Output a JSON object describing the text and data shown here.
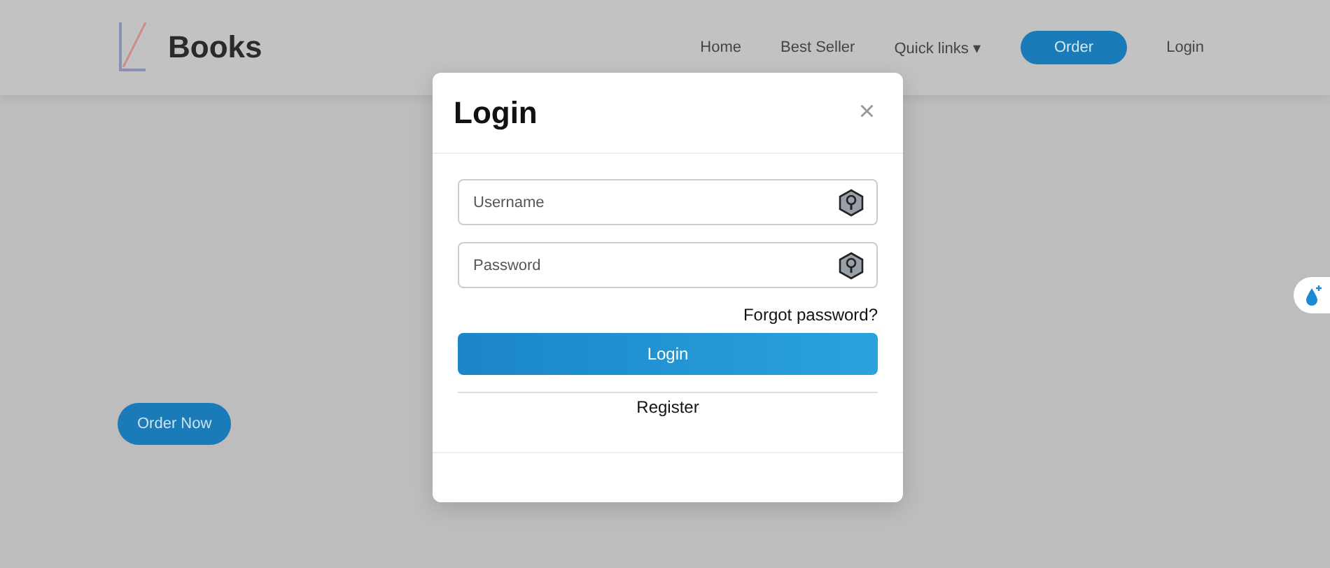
{
  "navbar": {
    "brand": "Books",
    "links": [
      {
        "label": "Home",
        "kind": "link"
      },
      {
        "label": "Best Seller",
        "kind": "link"
      },
      {
        "label": "Quick links ▾",
        "kind": "link"
      },
      {
        "label": "Order",
        "kind": "button"
      },
      {
        "label": "Login",
        "kind": "link"
      }
    ]
  },
  "hero": {
    "button": "Order Now"
  },
  "modal": {
    "title": "Login",
    "close": "×",
    "fields": [
      {
        "placeholder": "Username"
      },
      {
        "placeholder": "Password"
      }
    ],
    "forgot": "Forgot password?",
    "submit": "Login",
    "register": "Register"
  }
}
